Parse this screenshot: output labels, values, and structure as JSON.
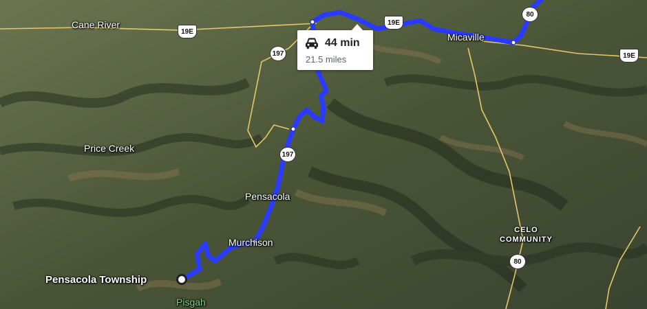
{
  "map": {
    "route": {
      "duration": "44 min",
      "distance": "21.5 miles",
      "mode_icon": "car-icon",
      "color": "#2a3bff"
    },
    "places": {
      "cane_river": "Cane River",
      "micaville": "Micaville",
      "price_creek": "Price Creek",
      "pensacola": "Pensacola",
      "murchison": "Murchison",
      "pensacola_township": "Pensacola Township",
      "celo_community_line1": "CELO",
      "celo_community_line2": "COMMUNITY",
      "pisgah": "Pisgah"
    },
    "shields": {
      "us19e_west": "19E",
      "us19e_center": "19E",
      "us19e_east": "19E",
      "nc197_north": "197",
      "nc197_south": "197",
      "nc80_north": "80",
      "nc80_south": "80"
    },
    "colors": {
      "terrain_dark": "#2f3a26",
      "terrain_mid": "#56623f",
      "ridge_brown": "#7a6a4a",
      "road_yellow": "#e8c86a"
    }
  }
}
